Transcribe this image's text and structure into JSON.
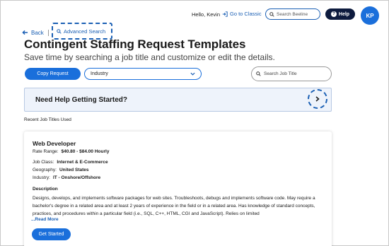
{
  "header": {
    "greeting": "Hello, Kevin",
    "goto_classic": "Go to Classic",
    "search_placeholder": "Search Beeline",
    "help_label": "Help",
    "avatar_initials": "KP"
  },
  "nav": {
    "back_label": "Back",
    "advanced_search_label": "Advanced Search"
  },
  "page": {
    "title": "Contingent Staffing Request Templates",
    "subtitle": "Save time by searching a job title and customize or edit the details."
  },
  "toolbar": {
    "copy_request_label": "Copy Request",
    "industry_selected": "Industry",
    "job_search_placeholder": "Search Job Title"
  },
  "help_card": {
    "title": "Need Help Getting Started?"
  },
  "recent": {
    "label": "Recent Job Titles Used"
  },
  "job_card": {
    "title": "Web Developer",
    "rate_label": "Rate Range:",
    "rate_value": "$40.80 - $84.00 Hourly",
    "job_class_label": "Job Class:",
    "job_class_value": "Internet & E-Commerce",
    "geography_label": "Geography:",
    "geography_value": "United States",
    "industry_label": "Industry:",
    "industry_value": "IT - Onshore/Offshore",
    "description_heading": "Description",
    "description_text": "Designs, develops, and implements software packages for web sites. Troubleshoots, debugs and implements software code. May require a bachelor's degree in a related area and at least 2 years of experience in the field or in a related area. Has knowledge of standard concepts, practices, and procedures within a particular field (i.e., SQL, C++, HTML, CGI and JavaScript). Relies on limited",
    "read_more": "...Read More",
    "get_started": "Get Started"
  },
  "colors": {
    "accent": "#1a6fdb",
    "link": "#1a5fb4",
    "help_button": "#0d1b3e",
    "help_card_bg": "#eef3fb"
  }
}
